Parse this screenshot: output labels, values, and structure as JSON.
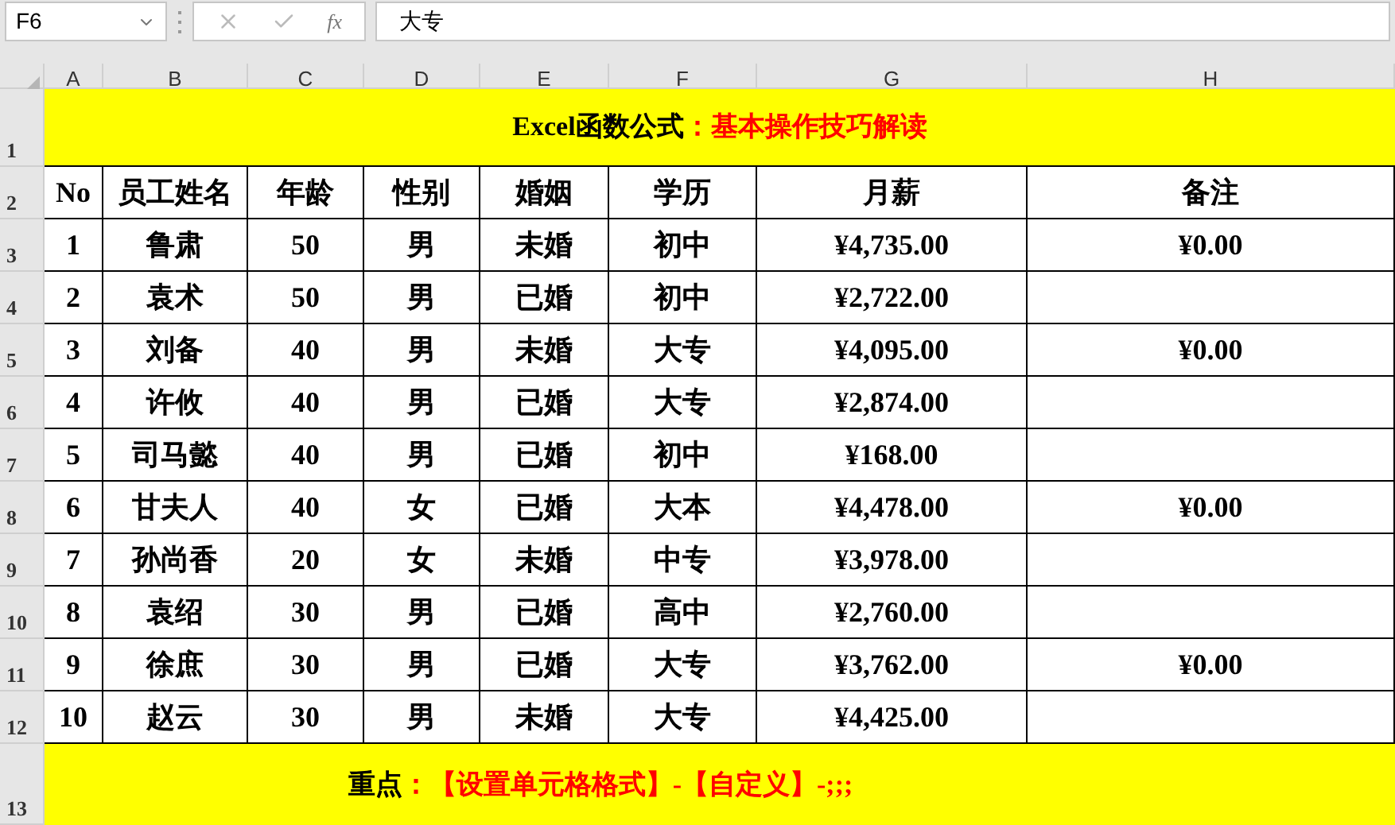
{
  "name_box": "F6",
  "function_button": "fx",
  "formula": "大专",
  "column_headers": [
    "A",
    "B",
    "C",
    "D",
    "E",
    "F",
    "G",
    "H"
  ],
  "row_numbers": [
    "1",
    "2",
    "3",
    "4",
    "5",
    "6",
    "7",
    "8",
    "9",
    "10",
    "11",
    "12",
    "13"
  ],
  "title": {
    "lead": "Excel函数公式",
    "rest": "：基本操作技巧解读"
  },
  "table_header": [
    "No",
    "员工姓名",
    "年龄",
    "性别",
    "婚姻",
    "学历",
    "月薪",
    "备注"
  ],
  "rows": [
    {
      "no": "1",
      "name": "鲁肃",
      "age": "50",
      "gender": "男",
      "marriage": "未婚",
      "education": "初中",
      "salary": "¥4,735.00",
      "note": "¥0.00"
    },
    {
      "no": "2",
      "name": "袁术",
      "age": "50",
      "gender": "男",
      "marriage": "已婚",
      "education": "初中",
      "salary": "¥2,722.00"
    },
    {
      "no": "3",
      "name": "刘备",
      "age": "40",
      "gender": "男",
      "marriage": "未婚",
      "education": "大专",
      "salary": "¥4,095.00",
      "note": "¥0.00"
    },
    {
      "no": "4",
      "name": "许攸",
      "age": "40",
      "gender": "男",
      "marriage": "已婚",
      "education": "大专",
      "salary": "¥2,874.00"
    },
    {
      "no": "5",
      "name": "司马懿",
      "age": "40",
      "gender": "男",
      "marriage": "已婚",
      "education": "初中",
      "salary": "¥168.00"
    },
    {
      "no": "6",
      "name": "甘夫人",
      "age": "40",
      "gender": "女",
      "marriage": "已婚",
      "education": "大本",
      "salary": "¥4,478.00",
      "note": "¥0.00"
    },
    {
      "no": "7",
      "name": "孙尚香",
      "age": "20",
      "gender": "女",
      "marriage": "未婚",
      "education": "中专",
      "salary": "¥3,978.00"
    },
    {
      "no": "8",
      "name": "袁绍",
      "age": "30",
      "gender": "男",
      "marriage": "已婚",
      "education": "高中",
      "salary": "¥2,760.00"
    },
    {
      "no": "9",
      "name": "徐庶",
      "age": "30",
      "gender": "男",
      "marriage": "已婚",
      "education": "大专",
      "salary": "¥3,762.00",
      "note": "¥0.00"
    },
    {
      "no": "10",
      "name": "赵云",
      "age": "30",
      "gender": "男",
      "marriage": "未婚",
      "education": "大专",
      "salary": "¥4,425.00"
    }
  ],
  "footer": {
    "lead": "重点",
    "rest": "：【设置单元格格式】-【自定义】-;;;"
  }
}
